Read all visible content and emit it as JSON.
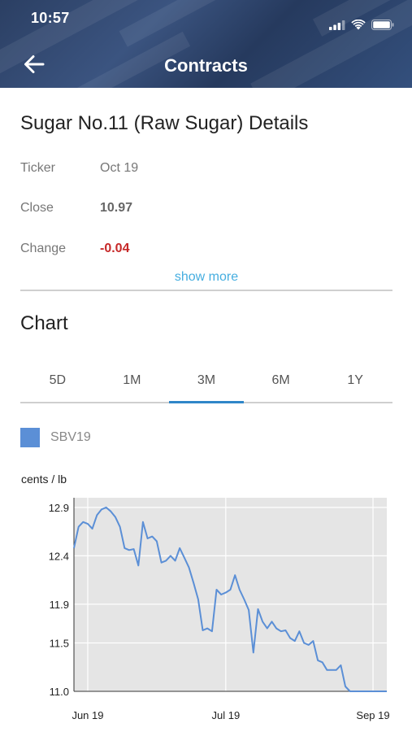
{
  "status_bar": {
    "time": "10:57"
  },
  "nav": {
    "title": "Contracts"
  },
  "details": {
    "title": "Sugar No.11 (Raw Sugar) Details",
    "rows": [
      {
        "label": "Ticker",
        "value": "Oct 19"
      },
      {
        "label": "Close",
        "value": "10.97"
      },
      {
        "label": "Change",
        "value": "-0.04"
      }
    ],
    "show_more": "show more"
  },
  "chart_section": {
    "heading": "Chart",
    "tabs": [
      "5D",
      "1M",
      "3M",
      "6M",
      "1Y"
    ],
    "active_tab": "3M"
  },
  "colors": {
    "line": "#5b8fd6",
    "negative": "#c62828",
    "link": "#46aee0",
    "tab_underline": "#2f86c8",
    "plot_bg": "#e5e5e5"
  },
  "chart_data": {
    "type": "line",
    "title": "",
    "ylabel": "cents / lb",
    "xlabel": "",
    "ylim": [
      11.0,
      13.0
    ],
    "y_ticks": [
      12.9,
      12.4,
      11.9,
      11.5,
      11.0
    ],
    "x_ticks": [
      {
        "label": "Jun 19",
        "x": 3
      },
      {
        "label": "Jul 19",
        "x": 33
      },
      {
        "label": "Sep 19",
        "x": 65
      }
    ],
    "x_range": [
      0,
      68
    ],
    "grid": true,
    "legend_position": "top-left",
    "series": [
      {
        "name": "SBV19",
        "x": [
          0,
          1,
          2,
          3,
          4,
          5,
          6,
          7,
          8,
          9,
          10,
          11,
          12,
          13,
          14,
          15,
          16,
          17,
          18,
          19,
          20,
          21,
          22,
          23,
          24,
          25,
          26,
          27,
          28,
          29,
          30,
          31,
          32,
          33,
          34,
          35,
          36,
          37,
          38,
          39,
          40,
          41,
          42,
          43,
          44,
          45,
          46,
          47,
          48,
          49,
          50,
          51,
          52,
          53,
          54,
          55,
          56,
          57,
          58,
          59,
          60,
          61,
          62,
          63,
          64,
          65,
          66,
          67,
          68
        ],
        "y": [
          12.48,
          12.7,
          12.75,
          12.73,
          12.68,
          12.82,
          12.88,
          12.9,
          12.86,
          12.8,
          12.7,
          12.48,
          12.46,
          12.47,
          12.3,
          12.75,
          12.58,
          12.6,
          12.55,
          12.33,
          12.35,
          12.4,
          12.35,
          12.48,
          12.38,
          12.28,
          12.12,
          11.95,
          11.63,
          11.65,
          11.62,
          12.05,
          12.0,
          12.02,
          12.05,
          12.2,
          12.05,
          11.95,
          11.84,
          11.4,
          11.85,
          11.72,
          11.65,
          11.72,
          11.65,
          11.62,
          11.63,
          11.55,
          11.52,
          11.62,
          11.5,
          11.48,
          11.52,
          11.32,
          11.3,
          11.22,
          11.22,
          11.22,
          11.27,
          11.05,
          11.0,
          10.99,
          10.98,
          10.97,
          10.97,
          10.97,
          10.97,
          10.97,
          10.97
        ]
      }
    ]
  }
}
